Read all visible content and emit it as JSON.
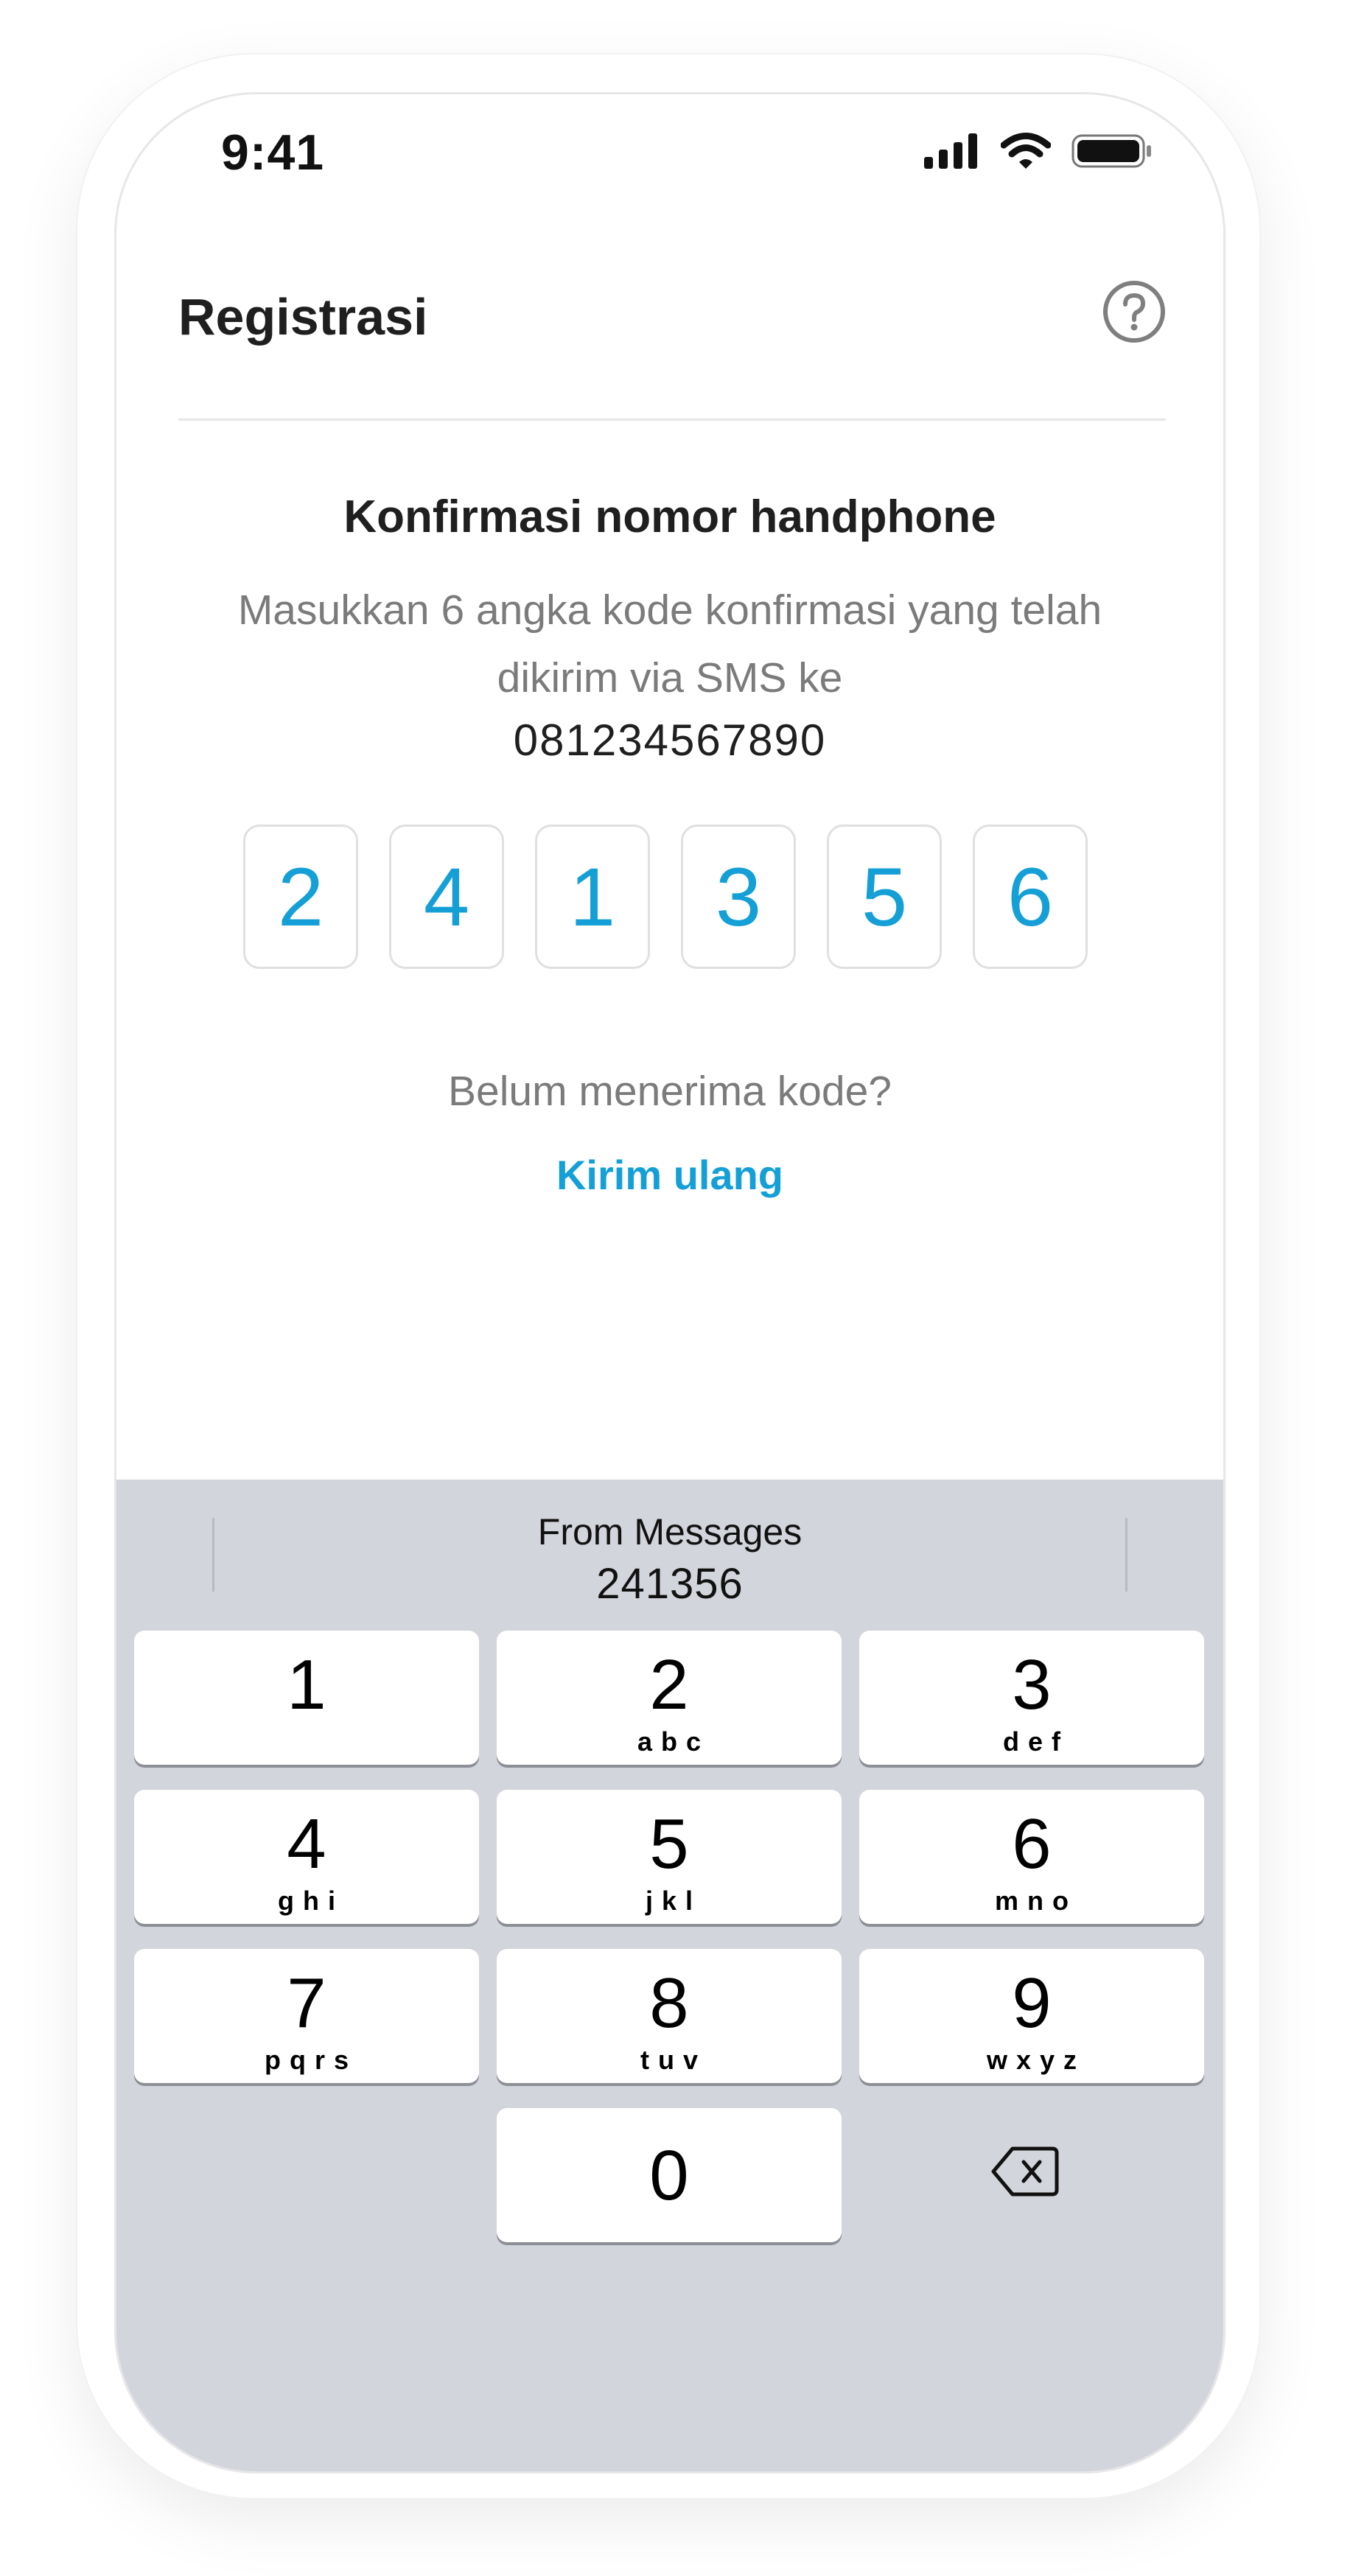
{
  "status_bar": {
    "time": "9:41",
    "icons": [
      "signal-icon",
      "wifi-icon",
      "battery-icon"
    ]
  },
  "header": {
    "title": "Registrasi",
    "help_icon": "question-circle-icon"
  },
  "content": {
    "title": "Konfirmasi nomor handphone",
    "instruction": "Masukkan 6 angka kode konfirmasi yang telah dikirim via SMS ke",
    "phone_number": "081234567890",
    "otp_digits": [
      "2",
      "4",
      "1",
      "3",
      "5",
      "6"
    ],
    "resend_question": "Belum menerima kode?",
    "resend_link": "Kirim ulang"
  },
  "keyboard": {
    "suggestion": {
      "label": "From Messages",
      "code": "241356"
    },
    "keys": [
      {
        "digit": "1",
        "letters": ""
      },
      {
        "digit": "2",
        "letters": "abc"
      },
      {
        "digit": "3",
        "letters": "def"
      },
      {
        "digit": "4",
        "letters": "ghi"
      },
      {
        "digit": "5",
        "letters": "jkl"
      },
      {
        "digit": "6",
        "letters": "mno"
      },
      {
        "digit": "7",
        "letters": "pqrs"
      },
      {
        "digit": "8",
        "letters": "tuv"
      },
      {
        "digit": "9",
        "letters": "wxyz"
      },
      {
        "digit": "0",
        "letters": ""
      }
    ],
    "delete_icon": "backspace-icon"
  },
  "colors": {
    "accent": "#149fd6",
    "keyboard_background": "#d3d5dc",
    "key_background": "#ffffff"
  }
}
